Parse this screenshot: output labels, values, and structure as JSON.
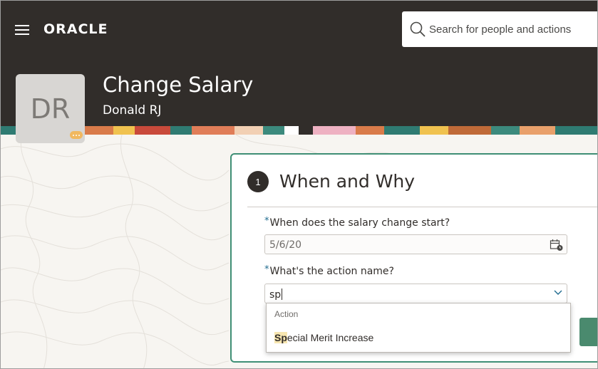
{
  "header": {
    "brand": "ORACLE",
    "search_placeholder": "Search for people and actions"
  },
  "person": {
    "initials": "DR",
    "page_title": "Change Salary",
    "name": "Donald RJ"
  },
  "section": {
    "step_number": "1",
    "title": "When and Why",
    "start_date_label": "When does the salary change start?",
    "start_date_value": "5/6/20",
    "action_label": "What's the action name?",
    "action_value": "sp",
    "required_marker": "*"
  },
  "dropdown": {
    "header": "Action",
    "option_match": "Sp",
    "option_rest": "ecial Merit Increase"
  },
  "colors": {
    "header_bg": "#312d2a",
    "card_border": "#3f8f75",
    "match_highlight": "#f7e6b0"
  }
}
